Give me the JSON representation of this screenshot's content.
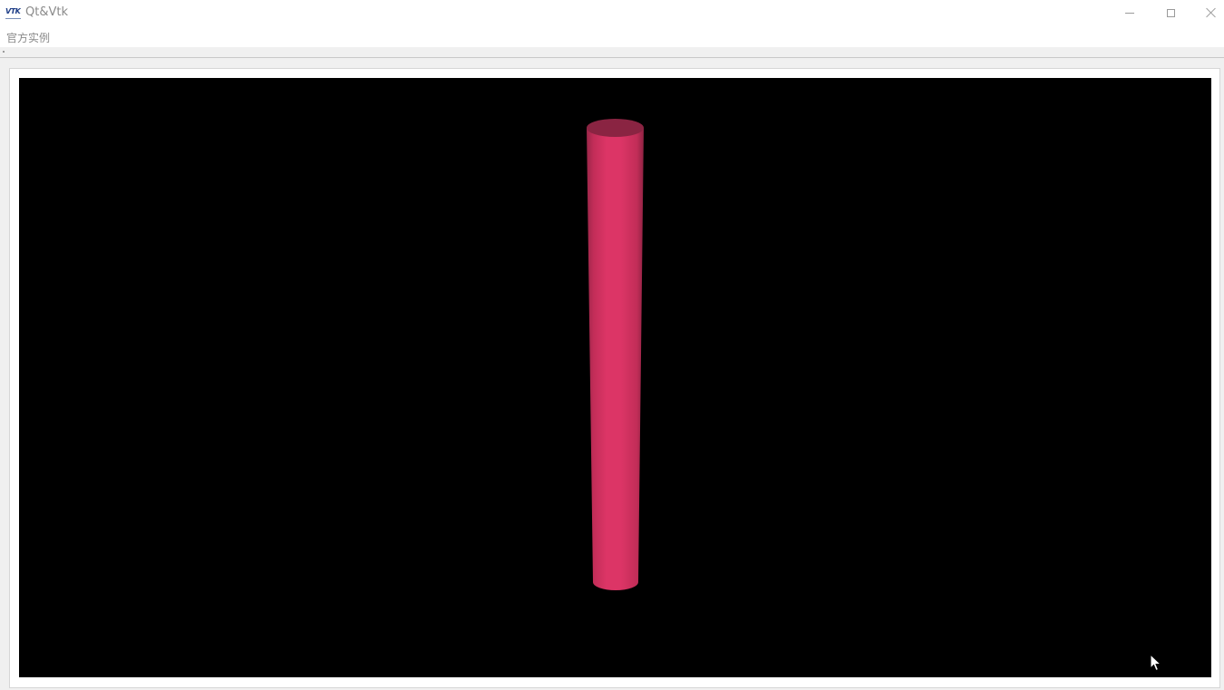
{
  "window": {
    "title": "Qt&Vtk",
    "app_icon_text": "VTK"
  },
  "menu": {
    "items": [
      "官方实例"
    ]
  },
  "viewport": {
    "background_color": "#000000",
    "object": "cylinder",
    "object_color": "#d63362"
  },
  "colors": {
    "title_text": "#8a8a8a",
    "window_bg": "#f0f0f0"
  }
}
